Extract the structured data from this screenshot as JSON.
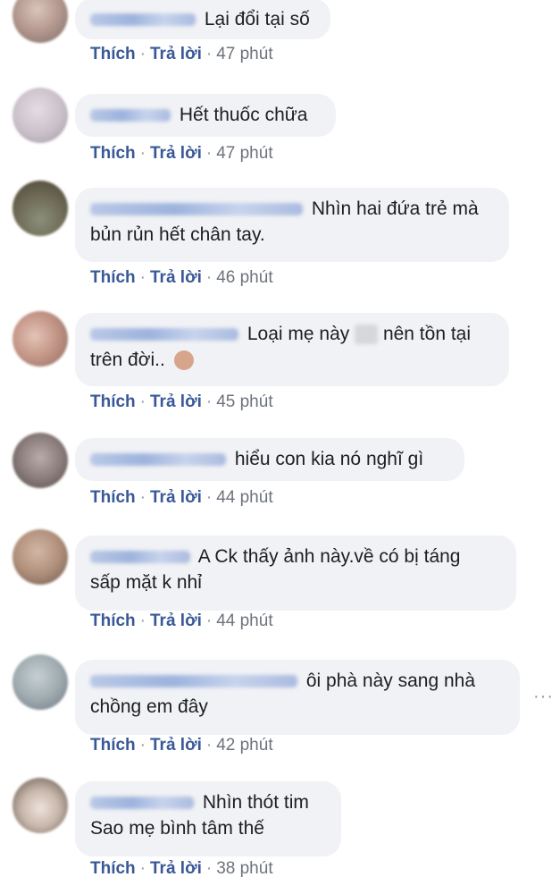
{
  "comments": [
    {
      "text": "Lại đổi tại số",
      "like": "Thích",
      "reply": "Trả lời",
      "time": "47 phút"
    },
    {
      "text": "Hết thuốc chữa",
      "like": "Thích",
      "reply": "Trả lời",
      "time": "47 phút"
    },
    {
      "text1": "Nhìn hai đứa trẻ mà",
      "text2": "bủn rủn hết chân tay.",
      "like": "Thích",
      "reply": "Trả lời",
      "time": "46 phút"
    },
    {
      "text1a": "Loại mẹ này",
      "text1b": "nên tồn tại",
      "text2": "trên đời..",
      "like": "Thích",
      "reply": "Trả lời",
      "time": "45 phút"
    },
    {
      "text": "hiểu con kia nó nghĩ gì",
      "like": "Thích",
      "reply": "Trả lời",
      "time": "44 phút"
    },
    {
      "text1": "A Ck thấy ảnh này.về có bị táng",
      "text2": "sấp mặt k nhỉ",
      "like": "Thích",
      "reply": "Trả lời",
      "time": "44 phút"
    },
    {
      "text1": "ôi phà này sang nhà",
      "text2": "chồng em đây",
      "like": "Thích",
      "reply": "Trả lời",
      "time": "42 phút"
    },
    {
      "text1": "Nhìn thót tim",
      "text2": "Sao mẹ bình tâm thế",
      "like": "Thích",
      "reply": "Trả lời",
      "time": "38 phút"
    }
  ],
  "more_icon": "more-horizontal-icon",
  "colors": {
    "link": "#385898",
    "bubble": "#f1f2f5",
    "time": "#6d737c"
  }
}
